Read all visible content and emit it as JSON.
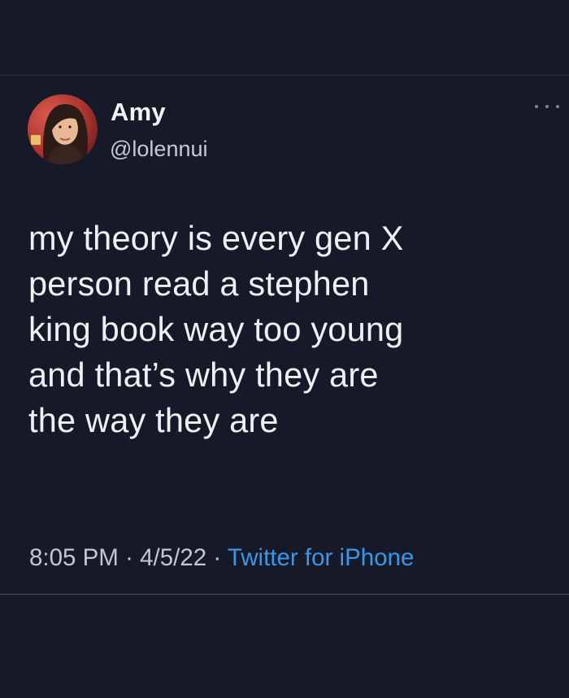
{
  "tweet": {
    "author": {
      "name": "Amy",
      "handle": "@lolennui"
    },
    "text_lines": [
      "my theory is every gen X",
      "person read a stephen",
      "king book way too young",
      "and that’s why they are",
      "the way they are"
    ],
    "time": "8:05 PM",
    "separator": "·",
    "date": "4/5/22",
    "source": "Twitter for iPhone"
  },
  "colors": {
    "background": "#171b29",
    "text": "#eef0f4",
    "secondary_text": "#c3c6ce",
    "link": "#3a97e8"
  },
  "icons": {
    "more": "more-horizontal-icon"
  }
}
